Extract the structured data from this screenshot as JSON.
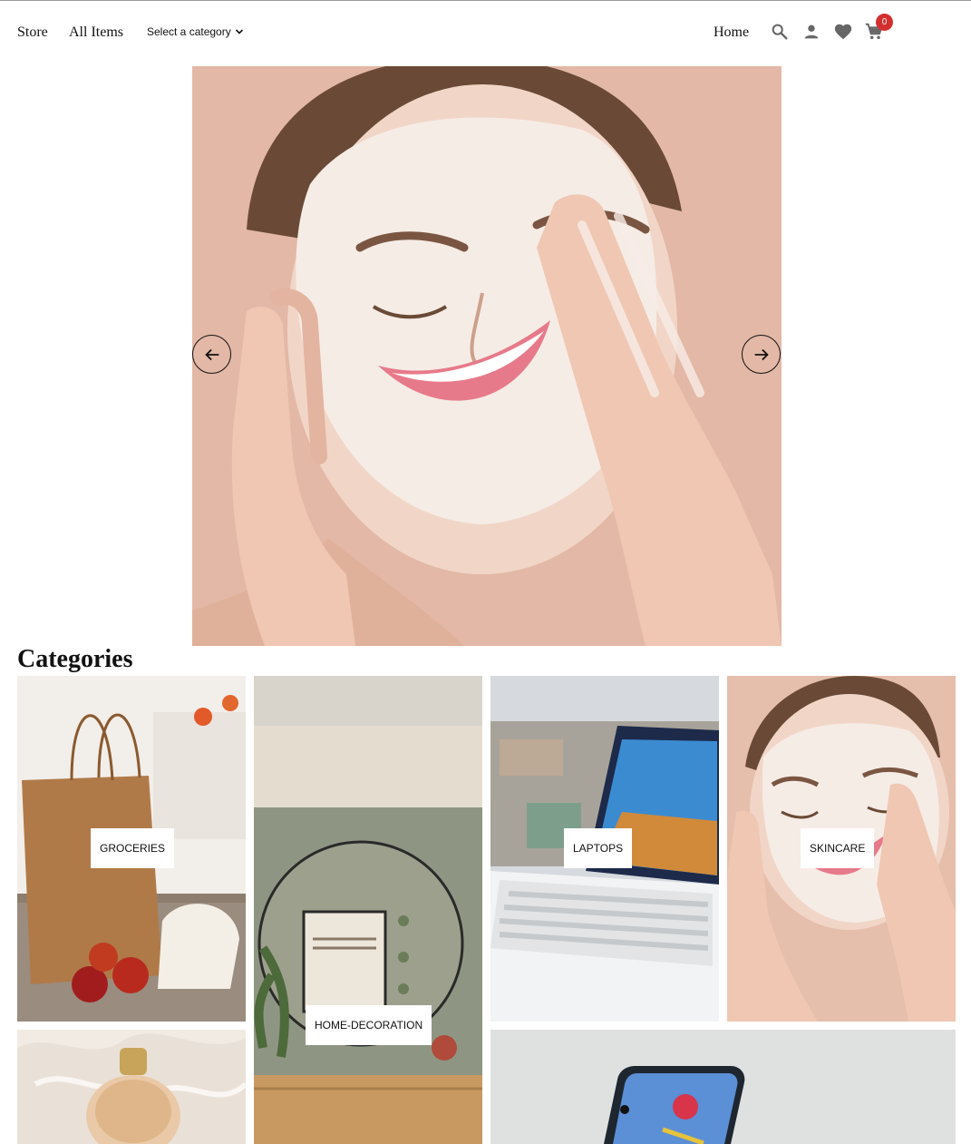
{
  "nav": {
    "store": "Store",
    "all_items": "All Items",
    "category_select": "Select a category",
    "home": "Home",
    "cart_count": "0",
    "icons": [
      "search-icon",
      "user-icon",
      "heart-icon",
      "cart-icon"
    ]
  },
  "hero": {
    "slide_image": "woman-face-wash-photo",
    "prev_icon": "arrow-left-icon",
    "next_icon": "arrow-right-icon"
  },
  "categories": {
    "title": "Categories",
    "items": [
      {
        "label": "GROCERIES",
        "image": "paper-bag-apples-photo"
      },
      {
        "label": "HOME-DECORATION",
        "image": "round-mirror-room-photo"
      },
      {
        "label": "LAPTOPS",
        "image": "laptop-city-view-photo"
      },
      {
        "label": "SKINCARE",
        "image": "woman-face-wash-photo"
      },
      {
        "label": "",
        "image": "perfume-bottle-fur-photo"
      },
      {
        "label": "",
        "image": "smartphone-photo"
      }
    ]
  },
  "colors": {
    "badge": "#d32f2f",
    "skin_bg": "#e6beac"
  }
}
